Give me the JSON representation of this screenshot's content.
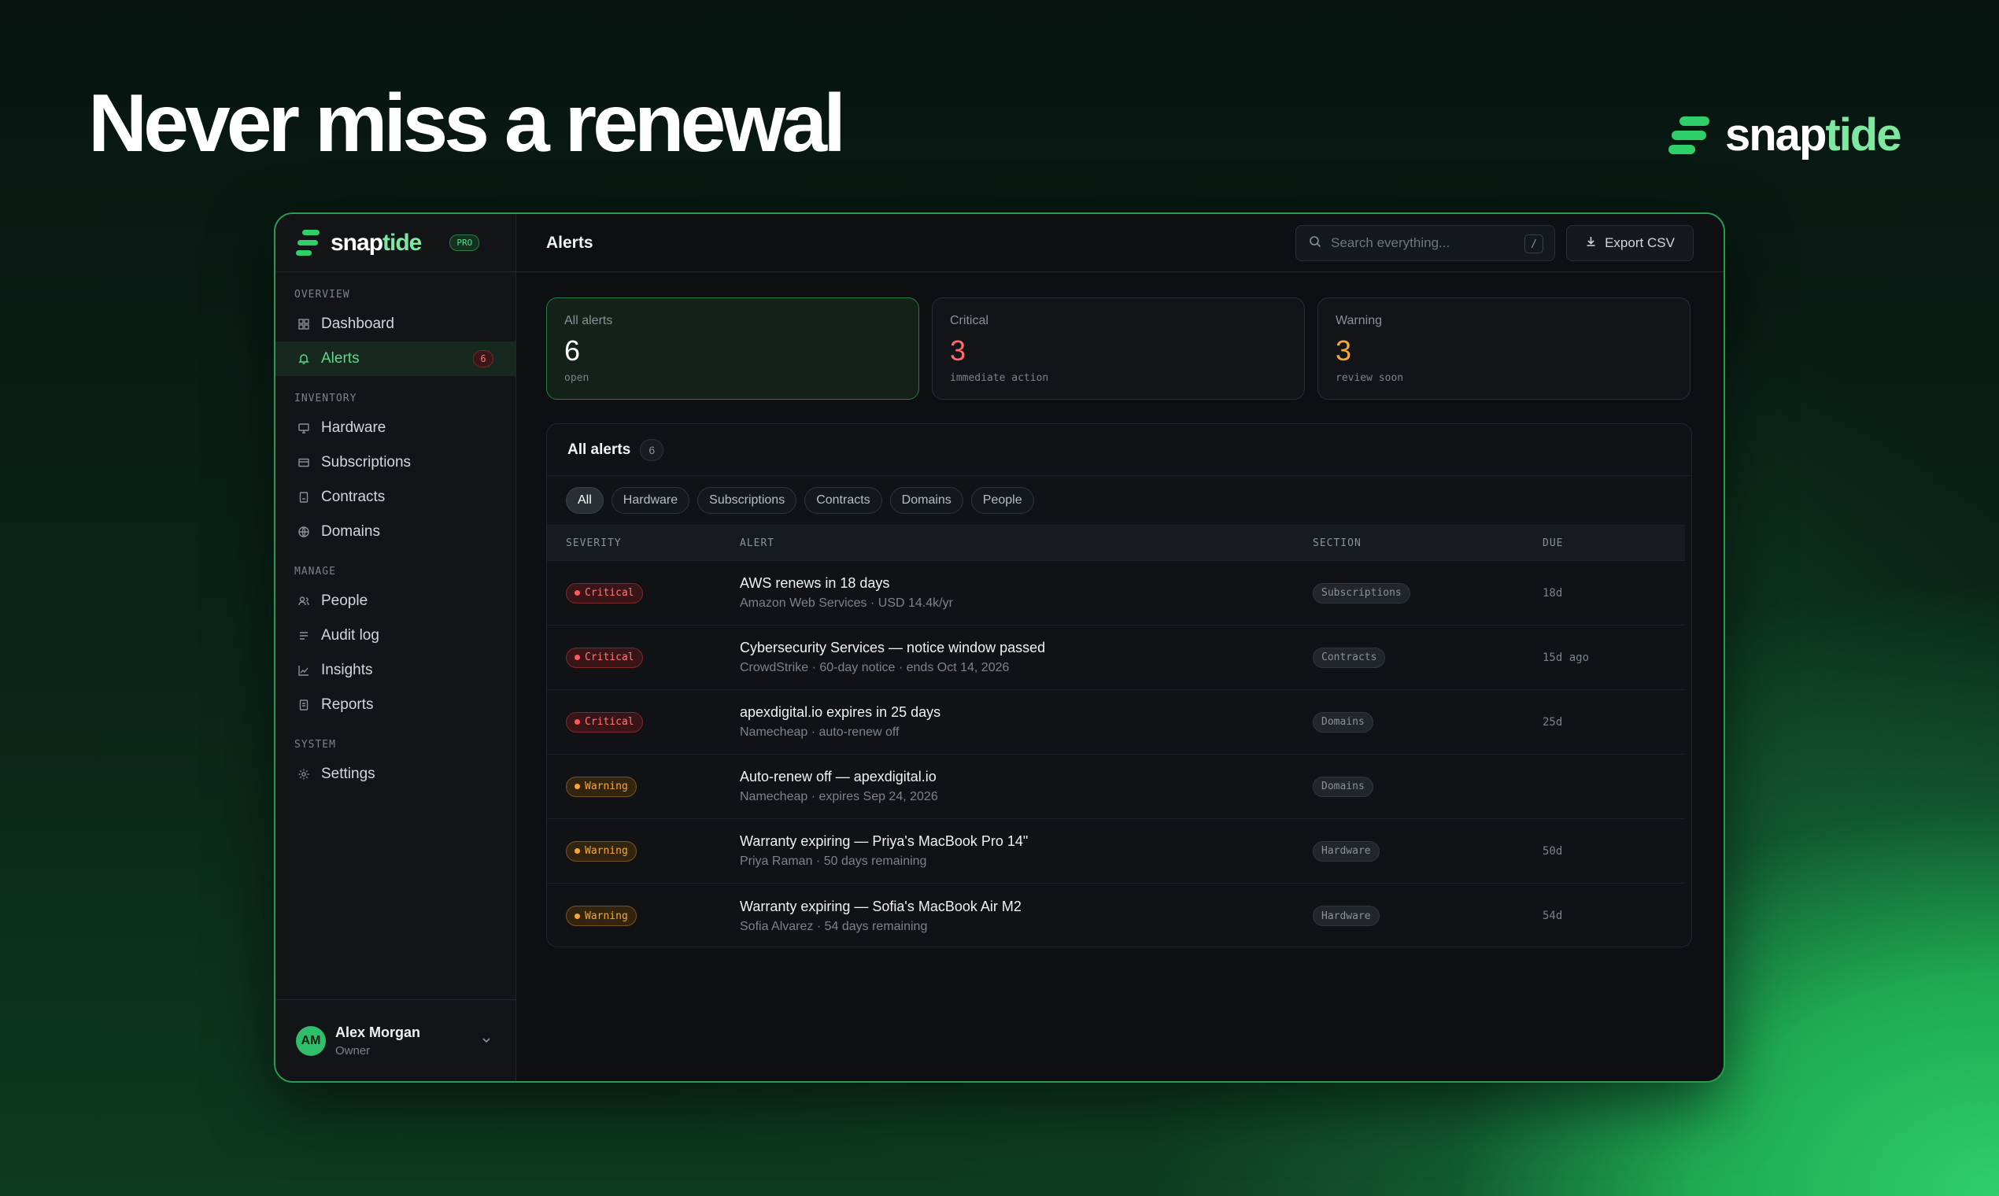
{
  "hero": {
    "title": "Never miss a renewal"
  },
  "brand": {
    "name_a": "snap",
    "name_b": "tide",
    "plan": "PRO",
    "accent": "#2fd06a"
  },
  "sidebar": {
    "sections": [
      {
        "label": "OVERVIEW",
        "items": [
          {
            "label": "Dashboard",
            "icon": "grid-icon",
            "active": false
          },
          {
            "label": "Alerts",
            "icon": "bell-icon",
            "active": true,
            "count": "6"
          }
        ]
      },
      {
        "label": "INVENTORY",
        "items": [
          {
            "label": "Hardware",
            "icon": "monitor-icon"
          },
          {
            "label": "Subscriptions",
            "icon": "card-icon"
          },
          {
            "label": "Contracts",
            "icon": "document-icon"
          },
          {
            "label": "Domains",
            "icon": "globe-icon"
          }
        ]
      },
      {
        "label": "MANAGE",
        "items": [
          {
            "label": "People",
            "icon": "users-icon"
          },
          {
            "label": "Audit log",
            "icon": "list-icon"
          },
          {
            "label": "Insights",
            "icon": "chart-icon"
          },
          {
            "label": "Reports",
            "icon": "report-icon"
          }
        ]
      },
      {
        "label": "SYSTEM",
        "items": [
          {
            "label": "Settings",
            "icon": "gear-icon"
          }
        ]
      }
    ],
    "user": {
      "initials": "AM",
      "name": "Alex Morgan",
      "role": "Owner"
    }
  },
  "topbar": {
    "title": "Alerts",
    "search_placeholder": "Search everything...",
    "search_shortcut": "/",
    "export_label": "Export CSV"
  },
  "stats": [
    {
      "label": "All alerts",
      "value": "6",
      "sub": "open"
    },
    {
      "label": "Critical",
      "value": "3",
      "sub": "immediate action"
    },
    {
      "label": "Warning",
      "value": "3",
      "sub": "review soon"
    }
  ],
  "panel": {
    "title": "All alerts",
    "count": "6",
    "filters": [
      "All",
      "Hardware",
      "Subscriptions",
      "Contracts",
      "Domains",
      "People"
    ],
    "columns": {
      "severity": "SEVERITY",
      "alert": "ALERT",
      "section": "SECTION",
      "due": "DUE"
    },
    "rows": [
      {
        "severity": "Critical",
        "title": "AWS renews in 18 days",
        "sub": "Amazon Web Services · USD 14.4k/yr",
        "section": "Subscriptions",
        "due": "18d"
      },
      {
        "severity": "Critical",
        "title": "Cybersecurity Services — notice window passed",
        "sub": "CrowdStrike · 60-day notice · ends Oct 14, 2026",
        "section": "Contracts",
        "due": "15d ago"
      },
      {
        "severity": "Critical",
        "title": "apexdigital.io expires in 25 days",
        "sub": "Namecheap · auto-renew off",
        "section": "Domains",
        "due": "25d"
      },
      {
        "severity": "Warning",
        "title": "Auto-renew off — apexdigital.io",
        "sub": "Namecheap · expires Sep 24, 2026",
        "section": "Domains",
        "due": ""
      },
      {
        "severity": "Warning",
        "title": "Warranty expiring — Priya's MacBook Pro 14\"",
        "sub": "Priya Raman · 50 days remaining",
        "section": "Hardware",
        "due": "50d"
      },
      {
        "severity": "Warning",
        "title": "Warranty expiring — Sofia's MacBook Air M2",
        "sub": "Sofia Alvarez · 54 days remaining",
        "section": "Hardware",
        "due": "54d"
      }
    ]
  }
}
